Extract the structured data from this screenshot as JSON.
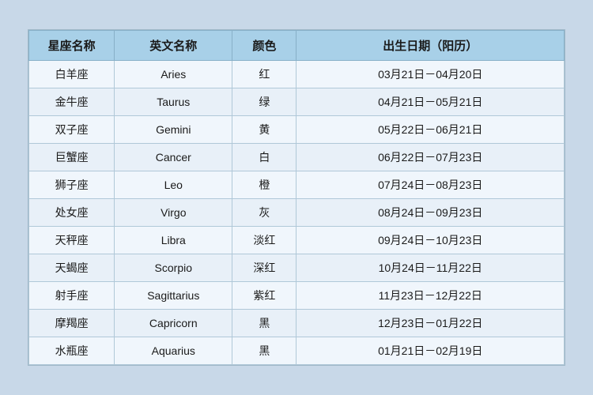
{
  "table": {
    "headers": {
      "chinese_name": "星座名称",
      "english_name": "英文名称",
      "color": "颜色",
      "date_range": "出生日期（阳历）"
    },
    "rows": [
      {
        "chinese": "白羊座",
        "english": "Aries",
        "color": "红",
        "date": "03月21日－04月20日"
      },
      {
        "chinese": "金牛座",
        "english": "Taurus",
        "color": "绿",
        "date": "04月21日－05月21日"
      },
      {
        "chinese": "双子座",
        "english": "Gemini",
        "color": "黄",
        "date": "05月22日－06月21日"
      },
      {
        "chinese": "巨蟹座",
        "english": "Cancer",
        "color": "白",
        "date": "06月22日－07月23日"
      },
      {
        "chinese": "狮子座",
        "english": "Leo",
        "color": "橙",
        "date": "07月24日－08月23日"
      },
      {
        "chinese": "处女座",
        "english": "Virgo",
        "color": "灰",
        "date": "08月24日－09月23日"
      },
      {
        "chinese": "天秤座",
        "english": "Libra",
        "color": "淡红",
        "date": "09月24日－10月23日"
      },
      {
        "chinese": "天蝎座",
        "english": "Scorpio",
        "color": "深红",
        "date": "10月24日－11月22日"
      },
      {
        "chinese": "射手座",
        "english": "Sagittarius",
        "color": "紫红",
        "date": "11月23日－12月22日"
      },
      {
        "chinese": "摩羯座",
        "english": "Capricorn",
        "color": "黑",
        "date": "12月23日－01月22日"
      },
      {
        "chinese": "水瓶座",
        "english": "Aquarius",
        "color": "黑",
        "date": "01月21日－02月19日"
      }
    ]
  }
}
